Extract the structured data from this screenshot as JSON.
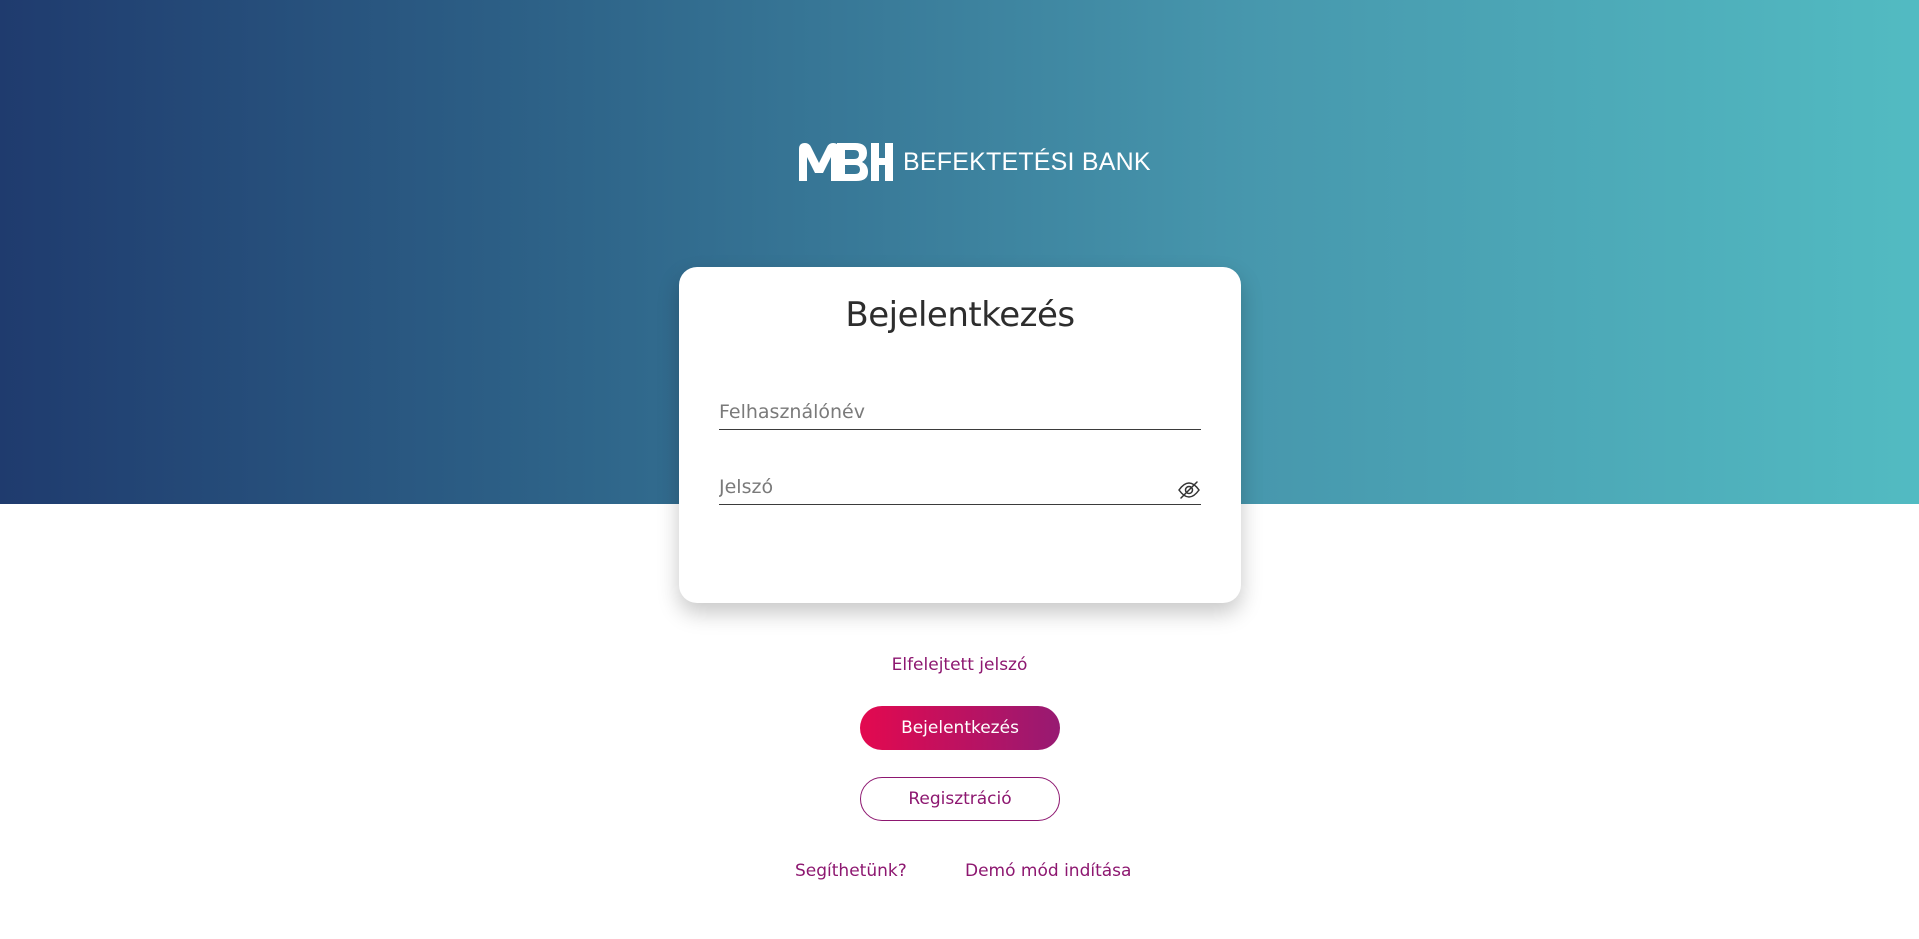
{
  "brand": {
    "logo_mark": "MBH",
    "logo_text": "BEFEKTETÉSI BANK"
  },
  "login_card": {
    "title": "Bejelentkezés",
    "username_placeholder": "Felhasználónév",
    "username_value": "",
    "password_placeholder": "Jelszó",
    "password_value": "",
    "password_toggle_icon": "eye-off-icon"
  },
  "links": {
    "forgot_password": "Elfelejtett jelszó",
    "help": "Segíthetünk?",
    "demo": "Demó mód indítása"
  },
  "buttons": {
    "login": "Bejelentkezés",
    "register": "Regisztráció"
  },
  "colors": {
    "gradient_start": "#1f3b6e",
    "gradient_end": "#52bbc2",
    "accent": "#8d1770",
    "primary_button_start": "#e3094f",
    "primary_button_end": "#971a72"
  }
}
